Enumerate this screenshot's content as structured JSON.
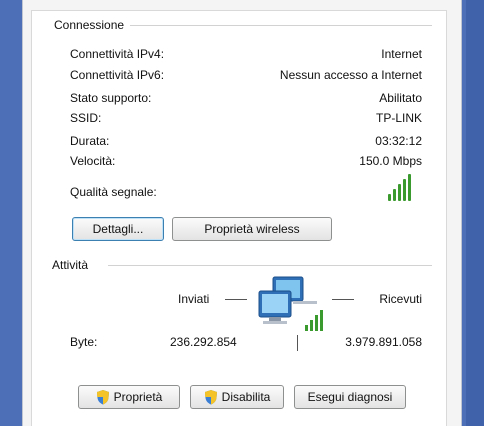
{
  "connection": {
    "title": "Connessione",
    "rows": [
      {
        "label": "Connettività IPv4:",
        "value": "Internet"
      },
      {
        "label": "Connettività IPv6:",
        "value": "Nessun accesso a Internet"
      },
      {
        "label": "Stato supporto:",
        "value": "Abilitato"
      },
      {
        "label": "SSID:",
        "value": "TP-LINK"
      },
      {
        "label": "Durata:",
        "value": "03:32:12"
      },
      {
        "label": "Velocità:",
        "value": "150.0 Mbps"
      }
    ],
    "signal_label": "Qualità segnale:",
    "signal_bars": 5,
    "details_button": "Dettagli...",
    "wireless_props_button": "Proprietà wireless"
  },
  "activity": {
    "title": "Attività",
    "sent_label": "Inviati",
    "received_label": "Ricevuti",
    "bytes_label": "Byte:",
    "bytes_sent": "236.292.854",
    "bytes_received": "3.979.891.058"
  },
  "footer": {
    "properties_button": "Proprietà",
    "disable_button": "Disabilita",
    "diagnose_button": "Esegui diagnosi"
  },
  "colors": {
    "background": "#4d6fb7",
    "signal": "#3b9a2e",
    "focus_border": "#3c7fb1"
  },
  "icons": [
    "signal-strength-icon",
    "network-computers-icon",
    "shield-icon"
  ]
}
